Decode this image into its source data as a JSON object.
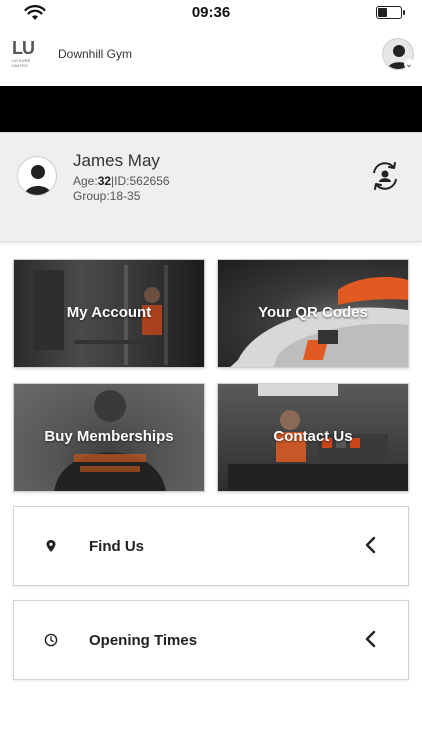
{
  "status_bar": {
    "time": "09:36",
    "battery_level": 0.45
  },
  "header": {
    "logo_mark": "LU",
    "logo_subtext": "LEISURE UNITED",
    "gym_name": "Downhill Gym",
    "avatar_caret": "⌄"
  },
  "profile": {
    "name": "James May",
    "age_label": "Age:",
    "age_value": "32",
    "separator": "|",
    "id_text": "ID:562656",
    "group_text": "Group:18-35"
  },
  "tiles": [
    {
      "label": "My Account"
    },
    {
      "label": "Your QR Codes"
    },
    {
      "label": "Buy Memberships"
    },
    {
      "label": "Contact Us"
    }
  ],
  "rows": [
    {
      "label": "Find Us",
      "icon": "map-pin-icon"
    },
    {
      "label": "Opening Times",
      "icon": "clock-icon"
    }
  ],
  "colors": {
    "banner": "#000000",
    "profile_background": "#efefef",
    "tile_text": "#ffffff",
    "accent_orange": "#e8541c"
  }
}
